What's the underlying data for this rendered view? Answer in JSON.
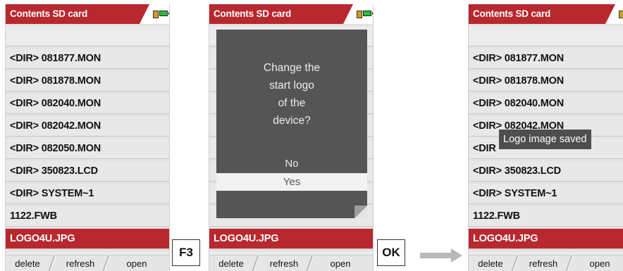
{
  "screens": [
    {
      "title": "Contents SD card",
      "rows": [
        "",
        "<DIR> 081877.MON",
        "<DIR> 081878.MON",
        "<DIR> 082040.MON",
        "<DIR> 082042.MON",
        "<DIR> 082050.MON",
        "<DIR> 350823.LCD",
        "<DIR> SYSTEM~1",
        "1122.FWB",
        "LOGO4U.JPG",
        ""
      ],
      "selected_index": 9,
      "footer": {
        "delete": "delete",
        "refresh": "refresh",
        "open": "open"
      }
    },
    {
      "title": "Contents SD card",
      "rows": [
        "",
        "",
        "",
        "",
        "",
        "",
        "",
        "",
        "",
        "LOGO4U.JPG",
        ""
      ],
      "selected_index": 9,
      "footer": {
        "delete": "delete",
        "refresh": "refresh",
        "open": "open"
      },
      "dialog": {
        "question_lines": [
          "Change the",
          "start logo",
          "of the",
          "device?"
        ],
        "option_no": "No",
        "option_yes": "Yes",
        "selected_option": "Yes"
      }
    },
    {
      "title": "Contents SD card",
      "rows": [
        "",
        "<DIR> 081877.MON",
        "<DIR> 081878.MON",
        "<DIR> 082040.MON",
        "<DIR> 082042.MON",
        "<DIR",
        "<DIR> 350823.LCD",
        "<DIR> SYSTEM~1",
        "1122.FWB",
        "LOGO4U.JPG",
        ""
      ],
      "selected_index": 9,
      "footer": {
        "delete": "delete",
        "refresh": "refresh",
        "open": "open"
      },
      "toast": "Logo image saved"
    }
  ],
  "keys": {
    "f3": "F3",
    "ok": "OK"
  },
  "icons": {
    "sd": "sd-card-icon",
    "battery": "battery-icon",
    "arrow": "right-arrow-icon"
  },
  "colors": {
    "header": "#b8282e",
    "selected_row": "#b8282e",
    "dialog_bg": "#555555",
    "battery": "#21c232"
  }
}
